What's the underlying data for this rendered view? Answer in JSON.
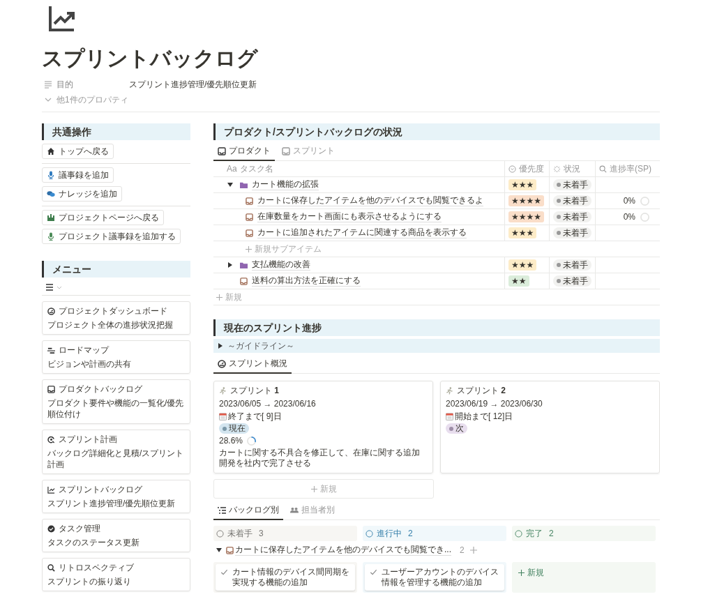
{
  "page": {
    "title": "スプリントバックログ",
    "properties": [
      {
        "label": "目的",
        "value": "スプリント進捗管理/優先順位更新"
      }
    ],
    "more_properties": "他1件のプロパティ"
  },
  "sidebar": {
    "common": {
      "heading": "共通操作",
      "groups": [
        [
          {
            "label": "トップへ戻る",
            "kind": "home"
          }
        ],
        [
          {
            "label": "議事録を追加",
            "kind": "mic"
          },
          {
            "label": "ナレッジを追加",
            "kind": "chat"
          }
        ],
        [
          {
            "label": "プロジェクトページへ戻る",
            "kind": "chart"
          },
          {
            "label": "プロジェクト議事録を追加する",
            "kind": "project-mic"
          }
        ]
      ]
    },
    "menu": {
      "heading": "メニュー",
      "cards": [
        {
          "title": "プロジェクトダッシュボード",
          "description": "プロジェクト全体の進捗状況把握",
          "kind": "gauge"
        },
        {
          "title": "ロードマップ",
          "description": "ビジョンや計画の共有",
          "kind": "roadmap"
        },
        {
          "title": "プロダクトバックログ",
          "description": "プロダクト要件や機能の一覧化/優先順位付け",
          "kind": "tray"
        },
        {
          "title": "スプリント計画",
          "description": "バックログ詳細化と見積/スプリント計画",
          "kind": "cycle"
        },
        {
          "title": "スプリントバックログ",
          "description": "スプリント進捗管理/優先順位更新",
          "kind": "trend"
        },
        {
          "title": "タスク管理",
          "description": "タスクのステータス更新",
          "kind": "check"
        },
        {
          "title": "リトロスペクティブ",
          "description": "スプリントの振り返り",
          "kind": "search"
        }
      ]
    }
  },
  "backlog_status": {
    "heading": "プロダクト/スプリントバックログの状況",
    "tabs": [
      {
        "label": "プロダクト",
        "selected": true
      },
      {
        "label": "スプリント",
        "selected": false
      }
    ],
    "columns": [
      {
        "label": "タスク名",
        "prefix": "Aa",
        "kind": "title"
      },
      {
        "label": "優先度",
        "kind": "select"
      },
      {
        "label": "状況",
        "kind": "status"
      },
      {
        "label": "進捗率(SP)",
        "kind": "formula"
      }
    ],
    "rows": [
      {
        "name": "カート機能の拡張",
        "kind": "folder",
        "expanded": true,
        "priority": {
          "text": "★★★",
          "color": "#fdecc8"
        },
        "status": "未着手",
        "add_label": "新規サブアイテム",
        "children": [
          {
            "name": "カートに保存したアイテムを他のデバイスでも閲覧できるよ",
            "kind": "task",
            "priority": {
              "text": "★★★★",
              "color": "#fadec9"
            },
            "status": "未着手",
            "progress": {
              "text": "0%",
              "level": 0
            }
          },
          {
            "name": "在庫数量をカート画面にも表示させるようにする",
            "kind": "task",
            "priority": {
              "text": "★★★★",
              "color": "#fadec9"
            },
            "status": "未着手",
            "progress": {
              "text": "0%",
              "level": 0
            }
          },
          {
            "name": "カートに追加されたアイテムに関連する商品を表示する",
            "kind": "task",
            "priority": {
              "text": "★★★",
              "color": "#fdecc8"
            },
            "status": "未着手"
          }
        ]
      },
      {
        "name": "支払機能の改善",
        "kind": "folder",
        "expanded": false,
        "priority": {
          "text": "★★★",
          "color": "#fdecc8"
        },
        "status": "未着手"
      },
      {
        "name": "送料の算出方法を正確にする",
        "kind": "task",
        "priority": {
          "text": "★★",
          "color": "#dbeddb"
        },
        "status": "未着手"
      }
    ],
    "add_label": "新規"
  },
  "sprint_progress": {
    "heading": "現在のスプリント進捗",
    "toggle": {
      "label": "～ガイドライン～",
      "expanded": false
    },
    "tabs": [
      {
        "label": "スプリント概況",
        "selected": true
      }
    ],
    "sprints": [
      {
        "title": "スプリント **1**",
        "dates": "2023/06/05 → 2023/06/16",
        "countdown": "終了まで[ 9]日",
        "tag": {
          "text": "現在",
          "color": "#d3e5ef"
        },
        "progress": {
          "text": "28.6%",
          "level": 0.286
        },
        "goal": "カートに関する不具合を修正して、在庫に関する追加開発を社内で完了させる"
      },
      {
        "title": "スプリント **2**",
        "dates": "2023/06/19 → 2023/06/30",
        "countdown": "開始まで[ 12]日",
        "tag": {
          "text": "次",
          "color": "#e8deee"
        }
      }
    ],
    "add_label": "新規",
    "board_tabs": [
      {
        "label": "バックログ別",
        "selected": true
      },
      {
        "label": "担当者別",
        "selected": false
      }
    ],
    "board_columns": [
      {
        "label": "未着手",
        "count": "3",
        "color": "#f7f6f3"
      },
      {
        "label": "進行中",
        "count": "2",
        "color": "#f1f8fb"
      },
      {
        "label": "完了",
        "count": "2",
        "color": "#f4f8f3"
      }
    ],
    "group": {
      "title": "カートに保存したアイテムを他のデバイスでも閲覧でき...",
      "count": "2",
      "expanded": true,
      "cards": [
        [
          "カート情報のデバイス間同期を実現する機能の追加"
        ],
        [
          "ユーザーアカウントのデバイス情報を管理する機能の追加"
        ]
      ],
      "add_label": "新規"
    }
  }
}
